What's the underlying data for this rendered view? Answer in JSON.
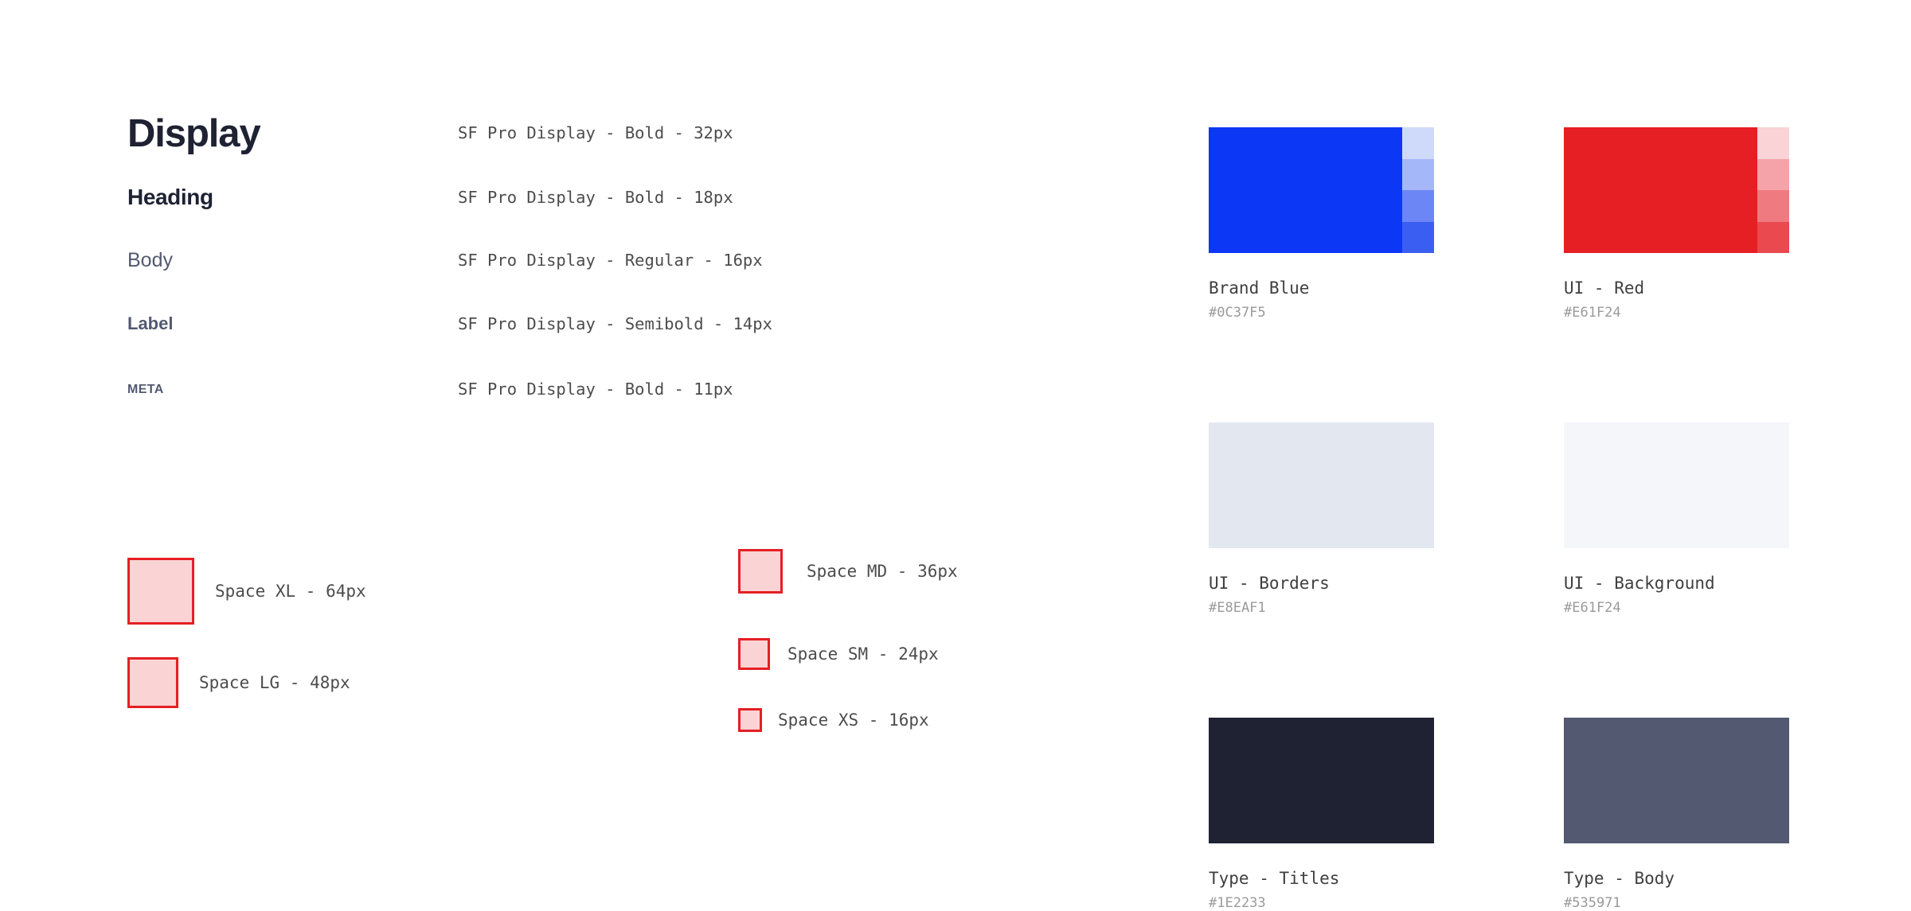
{
  "typography": {
    "rows": [
      {
        "sample": "Display",
        "spec": "SF Pro Display - Bold - 32px"
      },
      {
        "sample": "Heading",
        "spec": "SF Pro Display - Bold - 18px"
      },
      {
        "sample": "Body",
        "spec": "SF Pro Display - Regular - 16px"
      },
      {
        "sample": "Label",
        "spec": "SF Pro Display - Semibold - 14px"
      },
      {
        "sample": "META",
        "spec": "SF Pro Display - Bold - 11px"
      }
    ]
  },
  "spacing": {
    "fill_color": "#FAD3D4",
    "border_color": "#E61F24",
    "left_column": [
      {
        "label": "Space XL - 64px",
        "size": 84
      },
      {
        "label": "Space LG - 48px",
        "size": 64
      }
    ],
    "right_column": [
      {
        "label": "Space MD - 36px",
        "size": 56
      },
      {
        "label": "Space SM - 24px",
        "size": 40
      },
      {
        "label": "Space XS - 16px",
        "size": 30
      }
    ]
  },
  "colors": {
    "swatches": [
      {
        "name": "Brand Blue",
        "hex": "#0C37F5",
        "chip": "#0C37F5",
        "tints": [
          "#CFDAFB",
          "#A4B7F9",
          "#6C86F5",
          "#3B5EF2"
        ]
      },
      {
        "name": "UI - Red",
        "hex": "#E61F24",
        "chip": "#E61F24",
        "tints": [
          "#F9D3D5",
          "#F5A3A8",
          "#EF7A80",
          "#E9494F"
        ]
      },
      {
        "name": "UI - Borders",
        "hex": "#E8EAF1",
        "chip": "#E3E7F0",
        "tints": []
      },
      {
        "name": "UI - Background",
        "hex": "#E61F24",
        "chip": "#F4F6FA",
        "tints": []
      },
      {
        "name": "Type - Titles",
        "hex": "#1E2233",
        "chip": "#1E2233",
        "tints": []
      },
      {
        "name": "Type - Body",
        "hex": "#535971",
        "chip": "#535971",
        "tints": []
      }
    ]
  }
}
